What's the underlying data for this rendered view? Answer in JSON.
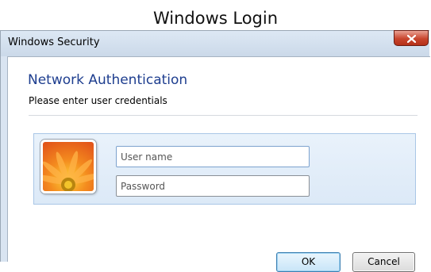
{
  "page": {
    "heading": "Windows Login"
  },
  "window": {
    "title": "Windows Security"
  },
  "dialog": {
    "title": "Network Authentication",
    "subtitle": "Please enter user credentials"
  },
  "credentials": {
    "username_placeholder": "User name",
    "username_value": "",
    "password_placeholder": "Password",
    "password_value": ""
  },
  "buttons": {
    "ok_label": "OK",
    "cancel_label": "Cancel"
  },
  "icons": {
    "close": "close-icon",
    "avatar": "flower-avatar-icon"
  },
  "colors": {
    "close_button": "#c8452d",
    "title_text": "#1e3e8f",
    "tile_background": "#e4eef9"
  }
}
